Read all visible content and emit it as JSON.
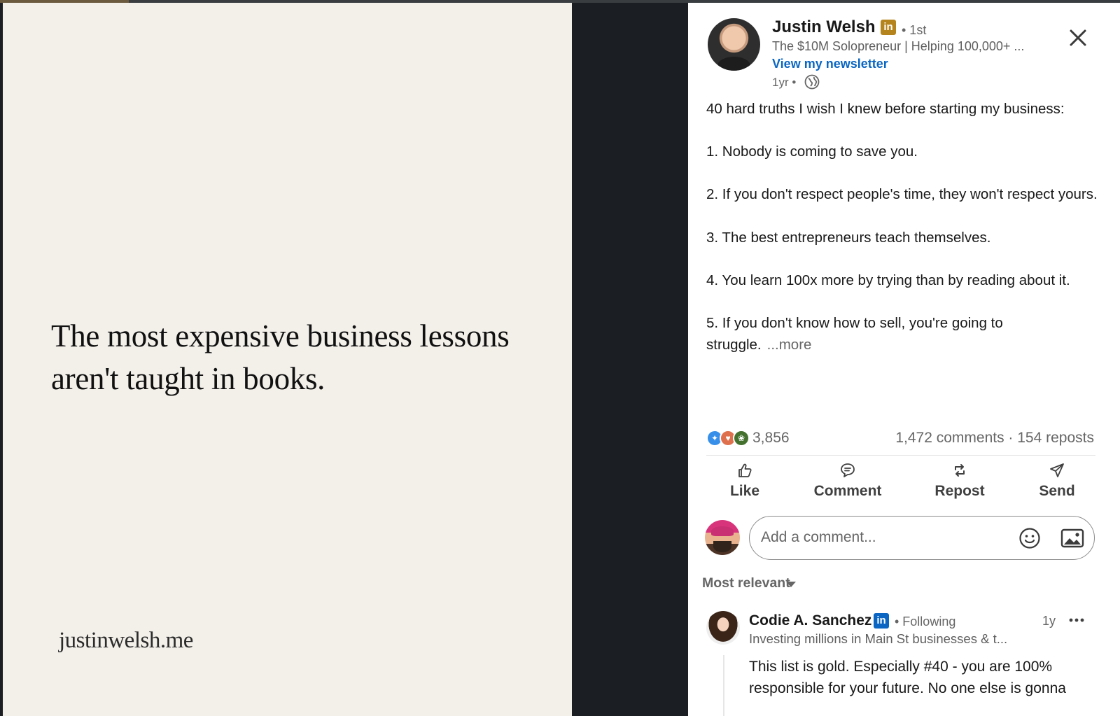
{
  "image_slide": {
    "quote": "The most expensive business lessons aren't taught in books.",
    "url": "justinwelsh.me",
    "progress": 0.115
  },
  "post": {
    "author": {
      "name": "Justin Welsh",
      "badge": "in",
      "degree": "• 1st",
      "headline": "The $10M Solopreneur | Helping 100,000+ ...",
      "newsletter_link": "View my newsletter",
      "time": "1yr •",
      "visibility_icon": "globe-icon"
    },
    "body": {
      "intro": "40 hard truths I wish I knew before starting my business:",
      "items": [
        "1. Nobody is coming to save you.",
        "2. If you don't respect people's time, they won't respect yours.",
        "3. The best entrepreneurs teach themselves.",
        "4. You learn 100x more by trying than by reading about it."
      ],
      "last_item": "5. If you don't know how to sell, you're going to struggle.",
      "more_label": "...more"
    },
    "reactions": {
      "icons": [
        "celebrate-icon",
        "love-icon",
        "support-icon"
      ],
      "count": "3,856",
      "comments_reposts": "1,472 comments · 154 reposts"
    },
    "actions": {
      "like": "Like",
      "comment": "Comment",
      "repost": "Repost",
      "send": "Send"
    }
  },
  "comment_box": {
    "placeholder": "Add a comment..."
  },
  "sort": {
    "label": "Most relevant"
  },
  "top_comment": {
    "name": "Codie A. Sanchez",
    "badge": "in",
    "relation": "• Following",
    "time": "1y",
    "headline": "Investing millions in Main St businesses & t...",
    "text": "This list is gold. Especially #40 - you are 100% responsible for your future. No one else is gonna"
  },
  "colors": {
    "link_blue": "#0a66c2",
    "premium_gold": "#b6841d",
    "slide_background": "#f3f0ea",
    "viewer_background": "#1b1f23"
  }
}
